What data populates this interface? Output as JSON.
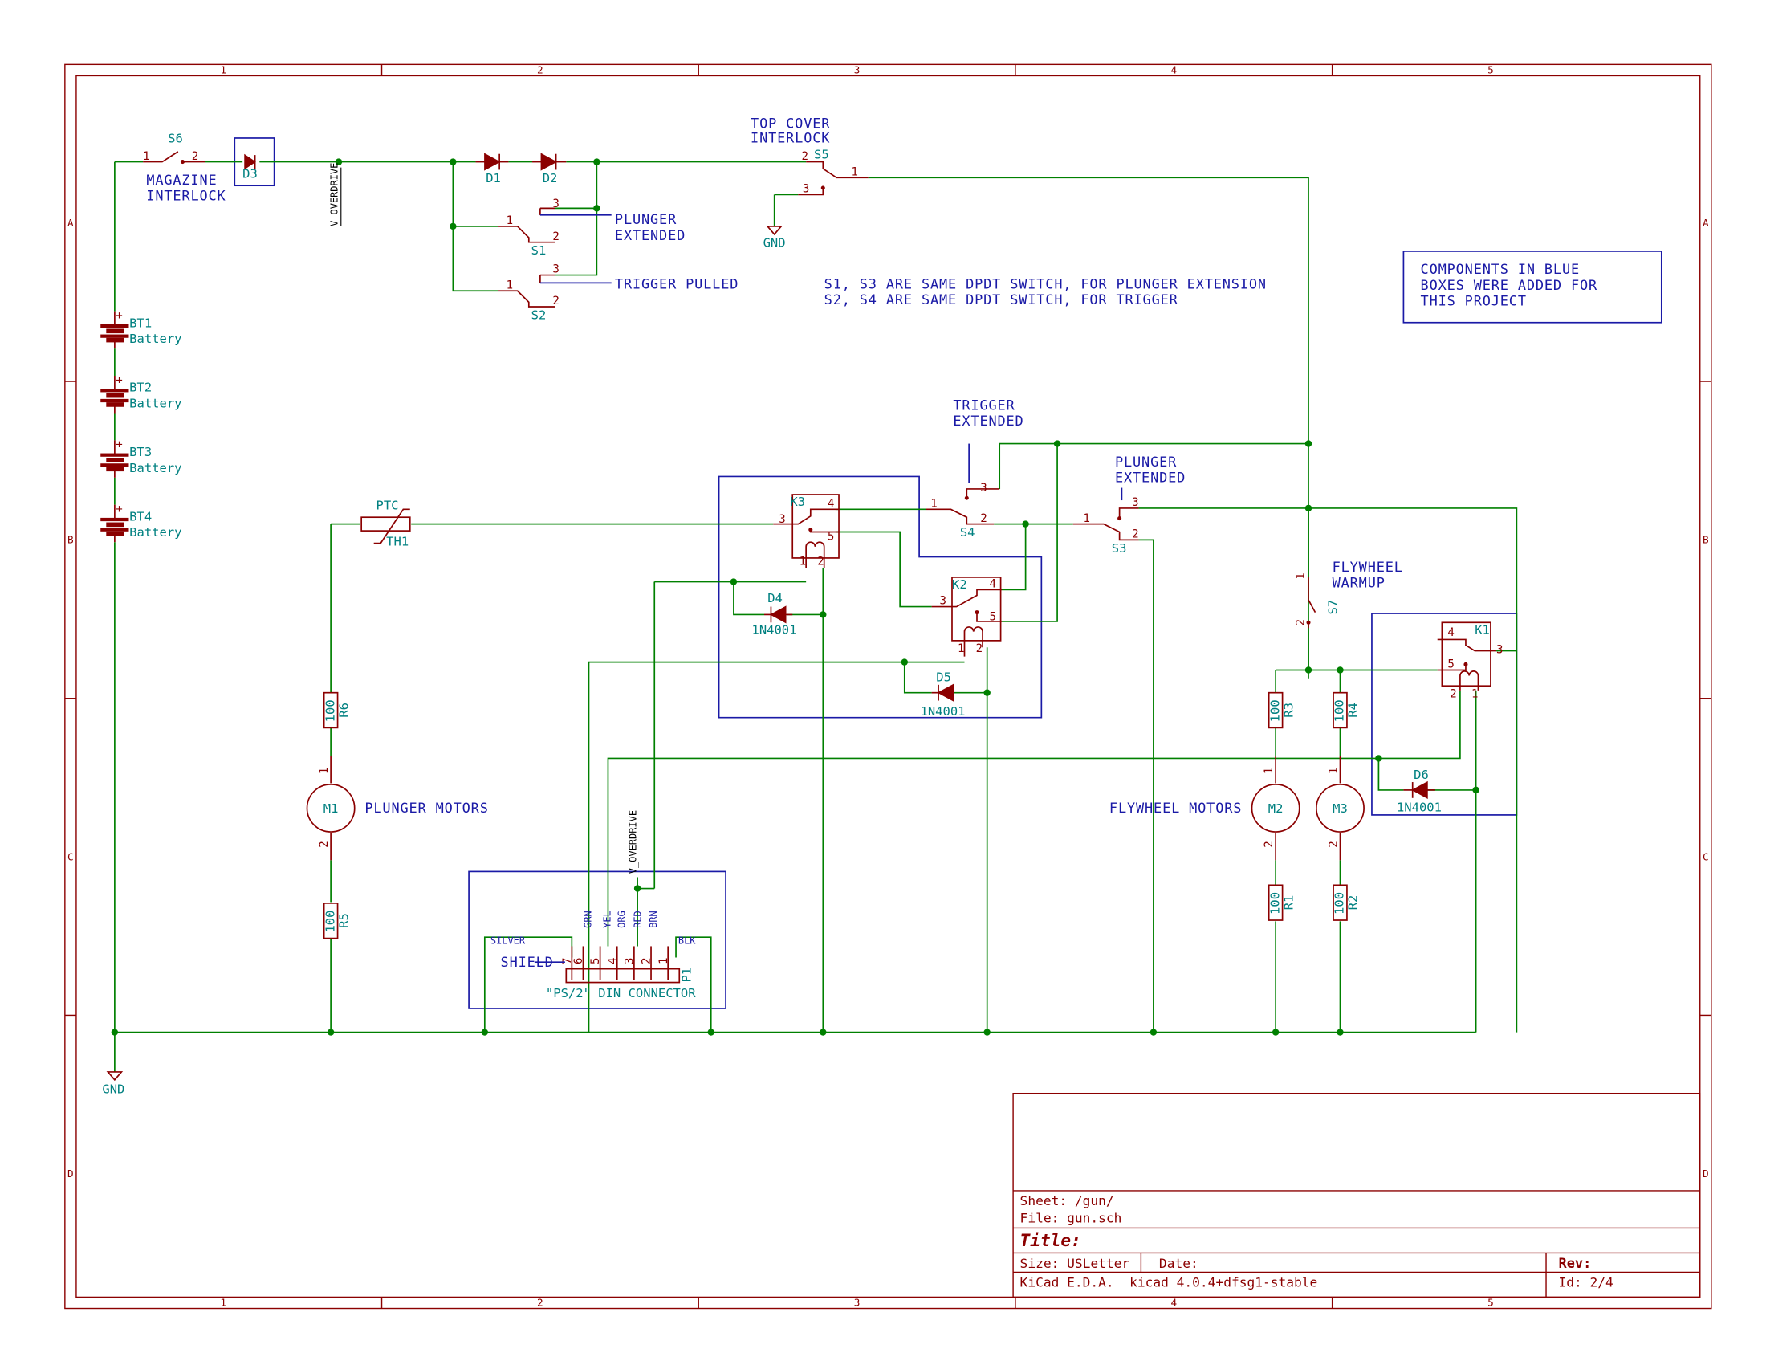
{
  "frame": {
    "columns": [
      "1",
      "2",
      "3",
      "4",
      "5"
    ],
    "rows": [
      "A",
      "B",
      "C",
      "D"
    ]
  },
  "components": {
    "S6": {
      "ref": "S6",
      "pins": [
        "1",
        "2"
      ],
      "label": "MAGAZINE\nINTERLOCK"
    },
    "D3": {
      "ref": "D3"
    },
    "D1": {
      "ref": "D1"
    },
    "D2": {
      "ref": "D2"
    },
    "S5": {
      "ref": "S5",
      "pins": [
        "2",
        "1",
        "3"
      ],
      "label": "TOP COVER\nINTERLOCK"
    },
    "S1": {
      "ref": "S1",
      "pins": [
        "1",
        "2",
        "3"
      ]
    },
    "S2": {
      "ref": "S2",
      "pins": [
        "1",
        "2",
        "3"
      ]
    },
    "S3": {
      "ref": "S3",
      "pins": [
        "1",
        "2",
        "3"
      ]
    },
    "S4": {
      "ref": "S4",
      "pins": [
        "1",
        "2",
        "3"
      ]
    },
    "S7": {
      "ref": "S7",
      "pins": [
        "1",
        "2"
      ]
    },
    "BT1": {
      "ref": "BT1",
      "value": "Battery"
    },
    "BT2": {
      "ref": "BT2",
      "value": "Battery"
    },
    "BT3": {
      "ref": "BT3",
      "value": "Battery"
    },
    "BT4": {
      "ref": "BT4",
      "value": "Battery"
    },
    "TH1": {
      "ref": "TH1",
      "value": "PTC"
    },
    "K1": {
      "ref": "K1",
      "pins": [
        "4",
        "3",
        "5",
        "2",
        "1"
      ]
    },
    "K2": {
      "ref": "K2",
      "pins": [
        "4",
        "3",
        "5",
        "1",
        "2"
      ]
    },
    "K3": {
      "ref": "K3",
      "pins": [
        "4",
        "3",
        "5",
        "1",
        "2"
      ]
    },
    "D4": {
      "ref": "D4",
      "value": "1N4001"
    },
    "D5": {
      "ref": "D5",
      "value": "1N4001"
    },
    "D6": {
      "ref": "D6",
      "value": "1N4001"
    },
    "R1": {
      "ref": "R1",
      "value": "100"
    },
    "R2": {
      "ref": "R2",
      "value": "100"
    },
    "R3": {
      "ref": "R3",
      "value": "100"
    },
    "R4": {
      "ref": "R4",
      "value": "100"
    },
    "R5": {
      "ref": "R5",
      "value": "100"
    },
    "R6": {
      "ref": "R6",
      "value": "100"
    },
    "M1": {
      "ref": "M1",
      "pins": [
        "1",
        "2"
      ]
    },
    "M2": {
      "ref": "M2",
      "pins": [
        "1",
        "2"
      ]
    },
    "M3": {
      "ref": "M3",
      "pins": [
        "1",
        "2"
      ]
    },
    "P1": {
      "ref": "P1",
      "value": "\"PS/2\" DIN CONNECTOR",
      "pins": [
        "7",
        "6",
        "5",
        "4",
        "3",
        "2",
        "1"
      ],
      "wire_labels": [
        "GRN",
        "YEL",
        "ORG",
        "RED",
        "BRN"
      ],
      "silver": "SILVER",
      "blk": "BLK",
      "shield": "SHIELD"
    }
  },
  "labels": {
    "plunger_extended_top": "PLUNGER\nEXTENDED",
    "trigger_pulled": "TRIGGER PULLED",
    "trigger_extended": "TRIGGER\nEXTENDED",
    "plunger_extended_mid": "PLUNGER\nEXTENDED",
    "flywheel_warmup": "FLYWHEEL\nWARMUP",
    "plunger_motors": "PLUNGER MOTORS",
    "flywheel_motors": "FLYWHEEL MOTORS",
    "note_line1": "S1, S3 ARE SAME DPDT SWITCH, FOR PLUNGER EXTENSION",
    "note_line2": "S2, S4 ARE SAME DPDT SWITCH, FOR TRIGGER",
    "blue_note": [
      "COMPONENTS IN BLUE",
      "BOXES WERE ADDED FOR",
      "THIS PROJECT"
    ],
    "net_v_overdrive": "V_OVERDRIVE",
    "gnd": "GND"
  },
  "title_block": {
    "sheet": "Sheet: /gun/",
    "file": "File: gun.sch",
    "title": "Title:",
    "size": "Size: USLetter",
    "date": "Date:",
    "rev": "Rev:",
    "tool": "KiCad E.D.A.  kicad 4.0.4+dfsg1-stable",
    "id": "Id: 2/4"
  }
}
